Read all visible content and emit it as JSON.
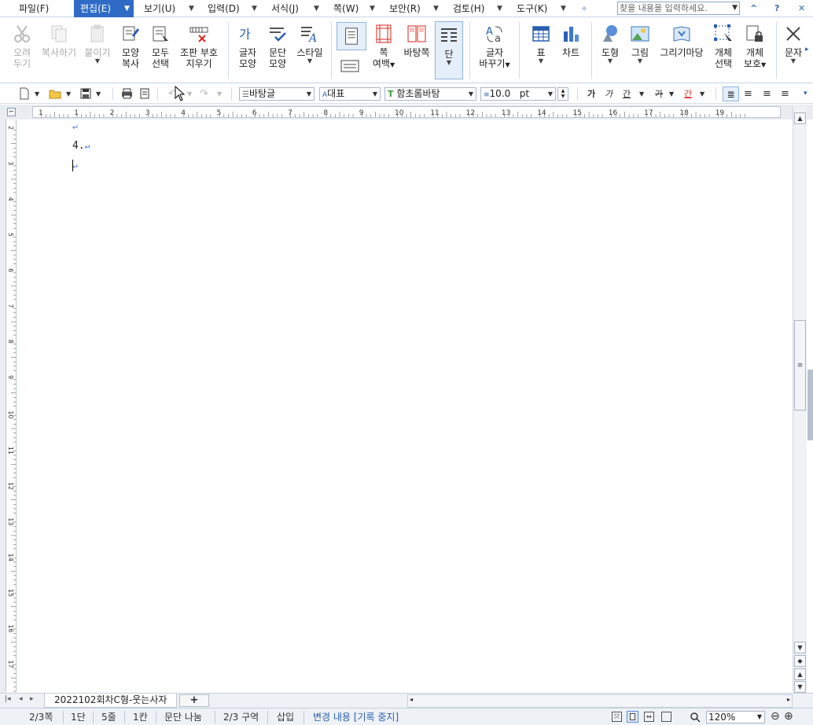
{
  "menu": {
    "items": [
      {
        "label": "파일(F)"
      },
      {
        "label": "편집(E)"
      },
      {
        "label": "보기(U)"
      },
      {
        "label": "입력(D)"
      },
      {
        "label": "서식(J)"
      },
      {
        "label": "쪽(W)"
      },
      {
        "label": "보안(R)"
      },
      {
        "label": "검토(H)"
      },
      {
        "label": "도구(K)"
      }
    ],
    "active": "편집(E)",
    "search_placeholder": "찾을 내용을 입력하세요.",
    "caret_up": "^",
    "help": "?"
  },
  "ribbon": {
    "cut": [
      "오려",
      "두기"
    ],
    "copy": "복사하기",
    "paste": "붙이기",
    "format_copy": [
      "모양",
      "복사"
    ],
    "select_all": [
      "모두",
      "선택"
    ],
    "clear_marks": [
      "조판 부호",
      "지우기"
    ],
    "char_shape": [
      "글자",
      "모양"
    ],
    "para_shape": [
      "문단",
      "모양"
    ],
    "style": "스타일",
    "page_margin": [
      "쪽",
      "여백"
    ],
    "bg_page": "바탕쪽",
    "column": "단",
    "replace": [
      "글자",
      "바꾸기"
    ],
    "table": "표",
    "chart": "차트",
    "shape": "도형",
    "picture": "그림",
    "gallery": "그리기마당",
    "obj_select": [
      "개체",
      "선택"
    ],
    "obj_protect": [
      "개체",
      "보호"
    ],
    "text_more": "문자"
  },
  "toolbar": {
    "style_value": "바탕글",
    "lang_value": "대표",
    "font_value": "함초롬바탕",
    "size_value": "10.0",
    "size_unit": "pt",
    "bold": "가",
    "italic": "가",
    "underline": "간",
    "strike": "가",
    "color": "간"
  },
  "ruler": {
    "h_ticks": [
      "1",
      "1",
      "2",
      "3",
      "4",
      "5",
      "6",
      "7",
      "8",
      "9",
      "10",
      "11",
      "12",
      "13",
      "14",
      "15",
      "16",
      "17",
      "18",
      "19"
    ],
    "v_ticks": [
      "2",
      "3",
      "4",
      "5",
      "6",
      "7",
      "8",
      "9",
      "10",
      "11",
      "12",
      "13",
      "14",
      "15",
      "16",
      "17"
    ]
  },
  "document": {
    "lines": [
      "",
      "4.",
      ""
    ],
    "para_mark": "↵"
  },
  "tabs": {
    "doc_name": "2022102회차C형-웃는사자",
    "add": "+"
  },
  "status": {
    "page": "2/3쪽",
    "column": "1단",
    "line": "5줄",
    "col": "1칸",
    "para_break": "문단 나눔",
    "section": "2/3 구역",
    "insert": "삽입",
    "track": "변경 내용 [기록 중지]",
    "zoom": "120%"
  }
}
